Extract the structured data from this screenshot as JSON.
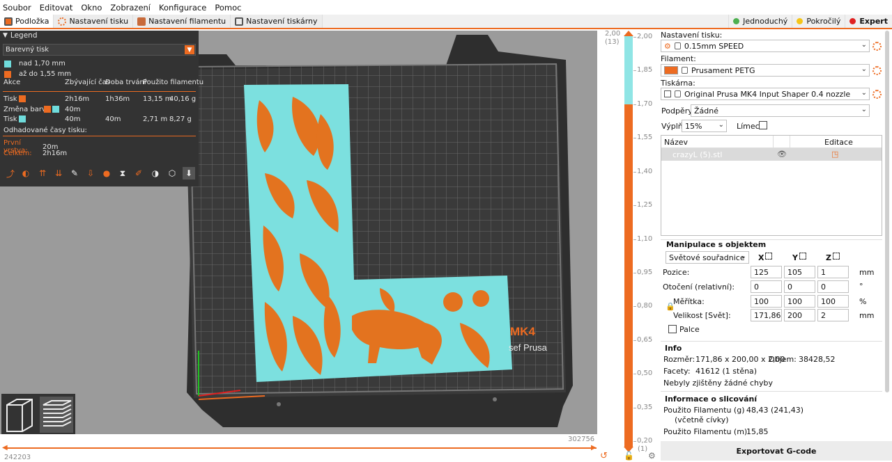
{
  "menu": [
    "Soubor",
    "Editovat",
    "Okno",
    "Zobrazení",
    "Konfigurace",
    "Pomoc"
  ],
  "tabs": [
    {
      "label": "Podložka",
      "icon": "bed-icon"
    },
    {
      "label": "Nastavení tisku",
      "icon": "gear-icon"
    },
    {
      "label": "Nastavení filamentu",
      "icon": "spool-icon"
    },
    {
      "label": "Nastavení tiskárny",
      "icon": "printer-icon"
    }
  ],
  "modes": [
    {
      "label": "Jednoduchý",
      "color": "#4caf50"
    },
    {
      "label": "Pokročilý",
      "color": "#f5c518"
    },
    {
      "label": "Expert",
      "color": "#e02020"
    }
  ],
  "legend": {
    "title": "Legend",
    "view_type": "Barevný tisk",
    "ranges": [
      {
        "label": "nad 1,70 mm",
        "color": "#6fdcdc"
      },
      {
        "label": "až do 1,55 mm",
        "color": "#ed6b21"
      }
    ],
    "columns": [
      "Akce",
      "Zbývající čas",
      "Doba trvání",
      "Použito filamentu"
    ],
    "rows": [
      {
        "action": "Tisk",
        "remaining": "2h16m",
        "duration": "1h36m",
        "length": "13,15 m",
        "weight": "40,16 g"
      },
      {
        "action": "Změna barvy",
        "remaining": "40m",
        "duration": "",
        "length": "",
        "weight": ""
      },
      {
        "action": "Tisk",
        "remaining": "40m",
        "duration": "40m",
        "length": "2,71 m",
        "weight": "8,27 g"
      }
    ],
    "estimated_label": "Odhadované časy tisku:",
    "first_layer_label": "První vrstva:",
    "first_layer_value": "20m",
    "total_label": "Celkem:",
    "total_value": "2h16m"
  },
  "bed": {
    "brand_text": "MK4",
    "brand_sub": "sef Prusa"
  },
  "hslider": {
    "left_value": "242203",
    "right_value": "302756"
  },
  "vslider": {
    "top_value": "2,00",
    "top_index": "(13)",
    "bottom_index": "(1)",
    "ticks": [
      "2,00",
      "1,85",
      "1,70",
      "1,55",
      "1,40",
      "1,25",
      "1,10",
      "0,95",
      "0,80",
      "0,65",
      "0,50",
      "0,35",
      "0,20"
    ]
  },
  "right": {
    "print_settings_label": "Nastavení tisku:",
    "print_settings_value": "0.15mm SPEED",
    "filament_label": "Filament:",
    "filament_value": "Prusament PETG",
    "filament_color": "#ed6b21",
    "printer_label": "Tiskárna:",
    "printer_value": "Original Prusa MK4 Input Shaper 0.4 nozzle",
    "supports_label": "Podpěry:",
    "supports_value": "Žádné",
    "infill_label": "Výplň:",
    "infill_value": "15%",
    "brim_label": "Límec:",
    "obj_col_name": "Název",
    "obj_col_edit": "Editace",
    "obj_name": "crazyL (5).stl",
    "manip_title": "Manipulace s objektem",
    "coord_system": "Světové souřadnice",
    "axes": [
      "X",
      "Y",
      "Z"
    ],
    "position_label": "Pozice:",
    "position": [
      "125",
      "105",
      "1"
    ],
    "position_unit": "mm",
    "rotation_label": "Otočení (relativní):",
    "rotation": [
      "0",
      "0",
      "0"
    ],
    "rotation_unit": "°",
    "scale_label": "Měřítka:",
    "scale": [
      "100",
      "100",
      "100"
    ],
    "scale_unit": "%",
    "size_label": "Velikost [Svět]:",
    "size": [
      "171,86",
      "200",
      "2"
    ],
    "size_unit": "mm",
    "inches_label": "Palce",
    "info_title": "Info",
    "dims_label": "Rozměr:",
    "dims_value": "171,86 x 200,00 x 2,00",
    "volume_label": "Objem:",
    "volume_value": "38428,52",
    "facets_label": "Facety:",
    "facets_value": "41612 (1 stěna)",
    "errors_text": "Nebyly zjištěny žádné chyby",
    "slice_title": "Informace o slicování",
    "fil_g_label": "Použito Filamentu (g)",
    "fil_g_sub": "(včetně cívky)",
    "fil_g_value": "48,43 (241,43)",
    "fil_m_label": "Použito Filamentu (m)",
    "fil_m_value": "15,85",
    "export_label": "Exportovat G-code"
  }
}
